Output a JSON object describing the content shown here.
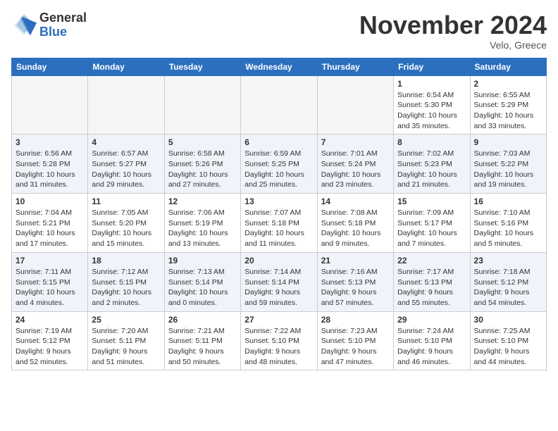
{
  "header": {
    "logo_general": "General",
    "logo_blue": "Blue",
    "month_title": "November 2024",
    "location": "Velo, Greece"
  },
  "weekdays": [
    "Sunday",
    "Monday",
    "Tuesday",
    "Wednesday",
    "Thursday",
    "Friday",
    "Saturday"
  ],
  "weeks": [
    [
      {
        "day": "",
        "info": ""
      },
      {
        "day": "",
        "info": ""
      },
      {
        "day": "",
        "info": ""
      },
      {
        "day": "",
        "info": ""
      },
      {
        "day": "",
        "info": ""
      },
      {
        "day": "1",
        "info": "Sunrise: 6:54 AM\nSunset: 5:30 PM\nDaylight: 10 hours\nand 35 minutes."
      },
      {
        "day": "2",
        "info": "Sunrise: 6:55 AM\nSunset: 5:29 PM\nDaylight: 10 hours\nand 33 minutes."
      }
    ],
    [
      {
        "day": "3",
        "info": "Sunrise: 6:56 AM\nSunset: 5:28 PM\nDaylight: 10 hours\nand 31 minutes."
      },
      {
        "day": "4",
        "info": "Sunrise: 6:57 AM\nSunset: 5:27 PM\nDaylight: 10 hours\nand 29 minutes."
      },
      {
        "day": "5",
        "info": "Sunrise: 6:58 AM\nSunset: 5:26 PM\nDaylight: 10 hours\nand 27 minutes."
      },
      {
        "day": "6",
        "info": "Sunrise: 6:59 AM\nSunset: 5:25 PM\nDaylight: 10 hours\nand 25 minutes."
      },
      {
        "day": "7",
        "info": "Sunrise: 7:01 AM\nSunset: 5:24 PM\nDaylight: 10 hours\nand 23 minutes."
      },
      {
        "day": "8",
        "info": "Sunrise: 7:02 AM\nSunset: 5:23 PM\nDaylight: 10 hours\nand 21 minutes."
      },
      {
        "day": "9",
        "info": "Sunrise: 7:03 AM\nSunset: 5:22 PM\nDaylight: 10 hours\nand 19 minutes."
      }
    ],
    [
      {
        "day": "10",
        "info": "Sunrise: 7:04 AM\nSunset: 5:21 PM\nDaylight: 10 hours\nand 17 minutes."
      },
      {
        "day": "11",
        "info": "Sunrise: 7:05 AM\nSunset: 5:20 PM\nDaylight: 10 hours\nand 15 minutes."
      },
      {
        "day": "12",
        "info": "Sunrise: 7:06 AM\nSunset: 5:19 PM\nDaylight: 10 hours\nand 13 minutes."
      },
      {
        "day": "13",
        "info": "Sunrise: 7:07 AM\nSunset: 5:18 PM\nDaylight: 10 hours\nand 11 minutes."
      },
      {
        "day": "14",
        "info": "Sunrise: 7:08 AM\nSunset: 5:18 PM\nDaylight: 10 hours\nand 9 minutes."
      },
      {
        "day": "15",
        "info": "Sunrise: 7:09 AM\nSunset: 5:17 PM\nDaylight: 10 hours\nand 7 minutes."
      },
      {
        "day": "16",
        "info": "Sunrise: 7:10 AM\nSunset: 5:16 PM\nDaylight: 10 hours\nand 5 minutes."
      }
    ],
    [
      {
        "day": "17",
        "info": "Sunrise: 7:11 AM\nSunset: 5:15 PM\nDaylight: 10 hours\nand 4 minutes."
      },
      {
        "day": "18",
        "info": "Sunrise: 7:12 AM\nSunset: 5:15 PM\nDaylight: 10 hours\nand 2 minutes."
      },
      {
        "day": "19",
        "info": "Sunrise: 7:13 AM\nSunset: 5:14 PM\nDaylight: 10 hours\nand 0 minutes."
      },
      {
        "day": "20",
        "info": "Sunrise: 7:14 AM\nSunset: 5:14 PM\nDaylight: 9 hours\nand 59 minutes."
      },
      {
        "day": "21",
        "info": "Sunrise: 7:16 AM\nSunset: 5:13 PM\nDaylight: 9 hours\nand 57 minutes."
      },
      {
        "day": "22",
        "info": "Sunrise: 7:17 AM\nSunset: 5:13 PM\nDaylight: 9 hours\nand 55 minutes."
      },
      {
        "day": "23",
        "info": "Sunrise: 7:18 AM\nSunset: 5:12 PM\nDaylight: 9 hours\nand 54 minutes."
      }
    ],
    [
      {
        "day": "24",
        "info": "Sunrise: 7:19 AM\nSunset: 5:12 PM\nDaylight: 9 hours\nand 52 minutes."
      },
      {
        "day": "25",
        "info": "Sunrise: 7:20 AM\nSunset: 5:11 PM\nDaylight: 9 hours\nand 51 minutes."
      },
      {
        "day": "26",
        "info": "Sunrise: 7:21 AM\nSunset: 5:11 PM\nDaylight: 9 hours\nand 50 minutes."
      },
      {
        "day": "27",
        "info": "Sunrise: 7:22 AM\nSunset: 5:10 PM\nDaylight: 9 hours\nand 48 minutes."
      },
      {
        "day": "28",
        "info": "Sunrise: 7:23 AM\nSunset: 5:10 PM\nDaylight: 9 hours\nand 47 minutes."
      },
      {
        "day": "29",
        "info": "Sunrise: 7:24 AM\nSunset: 5:10 PM\nDaylight: 9 hours\nand 46 minutes."
      },
      {
        "day": "30",
        "info": "Sunrise: 7:25 AM\nSunset: 5:10 PM\nDaylight: 9 hours\nand 44 minutes."
      }
    ]
  ]
}
